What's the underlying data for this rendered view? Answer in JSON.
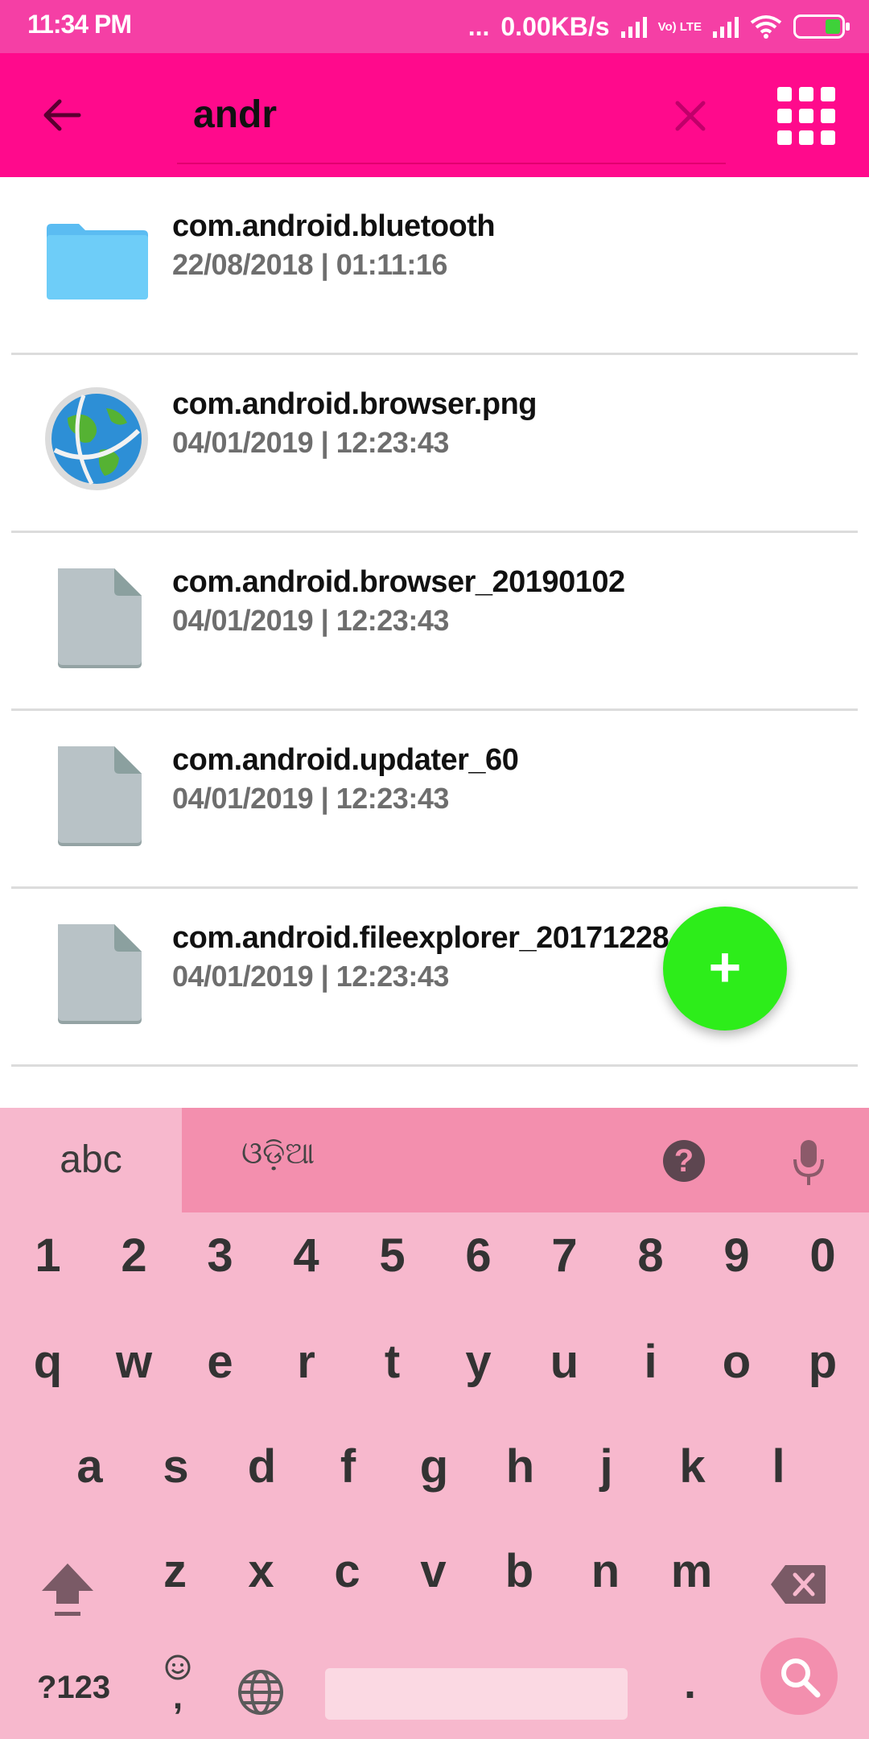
{
  "status_bar": {
    "time": "11:34 PM",
    "dots": "...",
    "net_speed": "0.00KB/s",
    "volte": "Vo) LTE"
  },
  "toolbar": {
    "search_value": "andr"
  },
  "files": [
    {
      "name": "com.android.bluetooth",
      "date": "22/08/2018 | 01:11:16",
      "icon": "folder-icon"
    },
    {
      "name": "com.android.browser.png",
      "date": "04/01/2019 | 12:23:43",
      "icon": "globe-image-icon"
    },
    {
      "name": "com.android.browser_20190102",
      "date": "04/01/2019 | 12:23:43",
      "icon": "file-icon"
    },
    {
      "name": "com.android.updater_60",
      "date": "04/01/2019 | 12:23:43",
      "icon": "file-icon"
    },
    {
      "name": "com.android.fileexplorer_20171228",
      "date": "04/01/2019 | 12:23:43",
      "icon": "file-icon"
    }
  ],
  "fab": {
    "label": "+"
  },
  "keyboard": {
    "tab_abc": "abc",
    "tab_odia": "ଓଡ଼ିଆ",
    "help": "?",
    "numbers": [
      "1",
      "2",
      "3",
      "4",
      "5",
      "6",
      "7",
      "8",
      "9",
      "0"
    ],
    "row_q": [
      "q",
      "w",
      "e",
      "r",
      "t",
      "y",
      "u",
      "i",
      "o",
      "p"
    ],
    "row_a": [
      "a",
      "s",
      "d",
      "f",
      "g",
      "h",
      "j",
      "k",
      "l"
    ],
    "row_z": [
      "z",
      "x",
      "c",
      "v",
      "b",
      "n",
      "m"
    ],
    "symbols": "?123",
    "comma": ",",
    "period": "."
  },
  "colors": {
    "status_bar": "#f53fa5",
    "toolbar": "#ff0a8c",
    "fab": "#2ded1a",
    "keyboard_bg": "#f7b8cd",
    "keyboard_top": "#f38fae"
  }
}
